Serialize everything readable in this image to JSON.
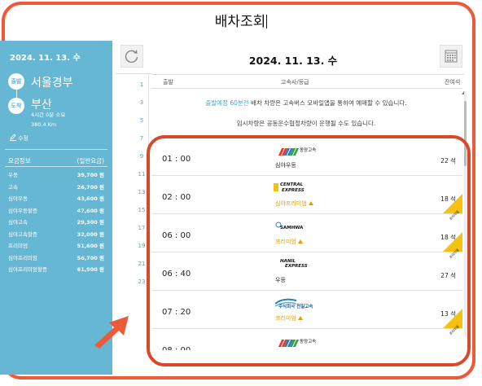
{
  "page_title": "배차조회",
  "left_panel": {
    "date": "2024. 11. 13. 수",
    "departure": {
      "badge": "출발",
      "name": "서울경부"
    },
    "arrival": {
      "badge": "도착",
      "name": "부산"
    },
    "duration": "4시간 0분 소요",
    "distance": "380.4 Km",
    "edit_label": "수정",
    "fare_header": {
      "title": "요금정보",
      "sub": "(일반요금)"
    },
    "fares": [
      {
        "name": "우등",
        "price": "39,700 원"
      },
      {
        "name": "고속",
        "price": "26,700 원"
      },
      {
        "name": "심야우등",
        "price": "43,600 원"
      },
      {
        "name": "심야우등할증",
        "price": "47,600 원"
      },
      {
        "name": "심야고속",
        "price": "29,300 원"
      },
      {
        "name": "심야고속할증",
        "price": "32,000 원"
      },
      {
        "name": "프리미엄",
        "price": "51,600 원"
      },
      {
        "name": "심야프리미엄",
        "price": "56,700 원"
      },
      {
        "name": "심야프리미엄할증",
        "price": "61,900 원"
      }
    ]
  },
  "side_numbers": [
    "1",
    "3",
    "5",
    "7",
    "9",
    "11",
    "13",
    "15",
    "17",
    "19",
    "21",
    "23"
  ],
  "main": {
    "date": "2024. 11. 13. 수",
    "columns": {
      "departure": "출발",
      "company_grade": "고속사/등급",
      "seats": "잔여석"
    },
    "notice_highlight": "출발예정 60분전",
    "notice_rest": " 배차 차량은 고속버스 모바일앱을 통하여 예매할 수 있습니다.",
    "notice2": "임시차량은 공동운수협정차량이 운행될 수도 있습니다.",
    "buses": [
      {
        "time": "01 : 00",
        "company": "동양고속",
        "grade": "심야우등",
        "seats": "22 석",
        "premium": false,
        "ribbon": ""
      },
      {
        "time": "02 : 00",
        "company": "CENTRAL EXPRESS",
        "grade": "심야프리미엄",
        "seats": "18 석",
        "premium": true,
        "ribbon": "프리미엄"
      },
      {
        "time": "06 : 00",
        "company": "SAMHWA",
        "grade": "프리미엄",
        "seats": "18 석",
        "premium": true,
        "ribbon": "프리미엄"
      },
      {
        "time": "06 : 40",
        "company": "HANIL EXPRESS",
        "grade": "우등",
        "seats": "27 석",
        "premium": false,
        "ribbon": ""
      },
      {
        "time": "07 : 20",
        "company": "주식회사 천일고속",
        "grade": "프리미엄",
        "seats": "13 석",
        "premium": true,
        "ribbon": "프리미엄"
      },
      {
        "time": "08 : 00",
        "company": "동양고속",
        "grade": "",
        "seats": "",
        "premium": false,
        "ribbon": ""
      }
    ]
  },
  "colors": {
    "panel": "#66b7d4",
    "accent": "#4aa9c9",
    "highlight": "#d8492a",
    "frame": "#ec5a3a",
    "premium": "#e0a000",
    "ribbon": "#f5c211"
  }
}
